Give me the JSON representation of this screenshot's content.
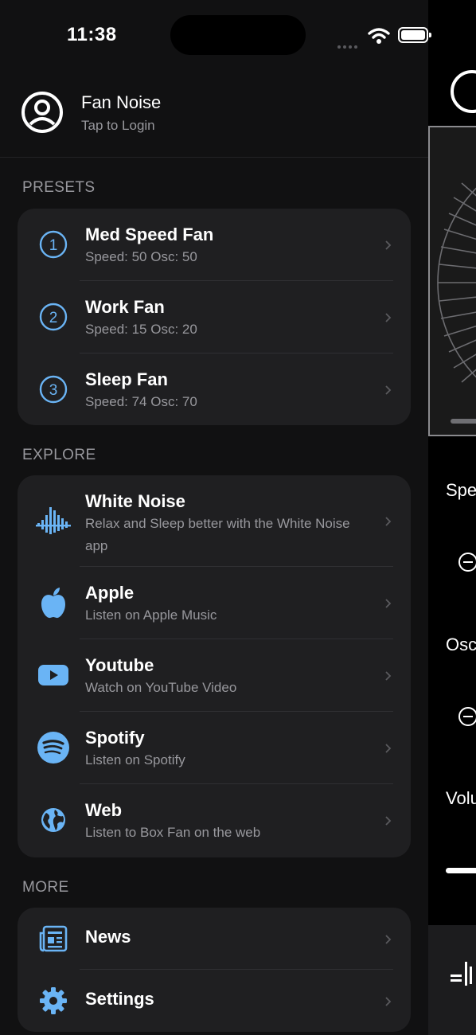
{
  "status_bar": {
    "time": "11:38"
  },
  "profile": {
    "title": "Fan Noise",
    "subtitle": "Tap to Login",
    "icon": "person-circle-icon"
  },
  "presets": {
    "header": "PRESETS",
    "items": [
      {
        "number": "1",
        "title": "Med Speed Fan",
        "subtitle": "Speed: 50 Osc: 50"
      },
      {
        "number": "2",
        "title": "Work Fan",
        "subtitle": "Speed: 15 Osc: 20"
      },
      {
        "number": "3",
        "title": "Sleep Fan",
        "subtitle": "Speed: 74 Osc: 70"
      }
    ]
  },
  "explore": {
    "header": "EXPLORE",
    "items": [
      {
        "icon": "sound-waves-icon",
        "title": "White Noise",
        "subtitle": "Relax and Sleep better with the White Noise app"
      },
      {
        "icon": "apple-logo-icon",
        "title": "Apple",
        "subtitle": "Listen on Apple Music"
      },
      {
        "icon": "youtube-icon",
        "title": "Youtube",
        "subtitle": "Watch on YouTube Video"
      },
      {
        "icon": "spotify-icon",
        "title": "Spotify",
        "subtitle": "Listen on Spotify"
      },
      {
        "icon": "globe-icon",
        "title": "Web",
        "subtitle": "Listen to Box Fan on the web"
      }
    ]
  },
  "more": {
    "header": "MORE",
    "items": [
      {
        "icon": "newspaper-icon",
        "title": "News"
      },
      {
        "icon": "gear-icon",
        "title": "Settings"
      }
    ]
  },
  "background_view": {
    "labels": [
      "Spe",
      "Osc",
      "Volu"
    ]
  },
  "colors": {
    "accent": "#6ab4f5",
    "drawer_bg": "#111112",
    "group_bg": "#1f1f21",
    "secondary_text": "#98989d"
  }
}
